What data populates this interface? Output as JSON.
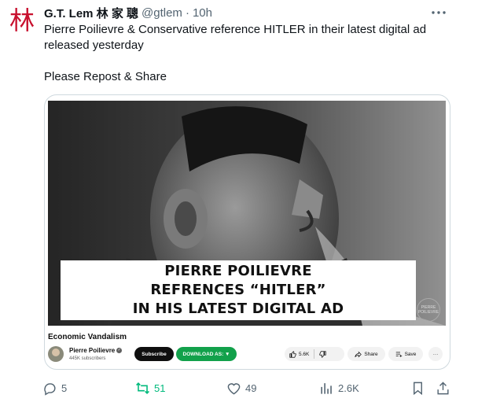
{
  "tweet": {
    "avatar_glyph": "林",
    "display_name": "G.T. Lem 林 家 聰",
    "handle": "@gtlem",
    "separator": "·",
    "time": "10h",
    "text_line1": "Pierre Poilievre & Conservative reference HITLER in their latest digital ad released yesterday",
    "text_line2": "Please Repost & Share"
  },
  "video": {
    "caption_lines": [
      "PIERRE POILIEVRE",
      "REFRENCES “HITLER”",
      "IN HIS LATEST DIGITAL AD"
    ],
    "watermark_text": "PIERRE POILIEVRE",
    "title": "Economic Vandalism",
    "channel_name": "Pierre Poilievre",
    "subscribers": "445K subscribers",
    "subscribe_label": "Subscribe",
    "download_label": "DOWNLOAD AS: ▼",
    "like_count": "5.6K",
    "share_label": "Share",
    "save_label": "Save",
    "more_label": "···"
  },
  "actions": {
    "replies": "5",
    "reposts": "51",
    "likes": "49",
    "views": "2.6K"
  },
  "colors": {
    "avatar_red": "#c8102e",
    "retweet_green": "#00ba7c",
    "muted_text": "#536471",
    "download_green": "#12a14b"
  },
  "icons": [
    "more-icon",
    "reply-icon",
    "repost-icon",
    "like-icon",
    "views-icon",
    "bookmark-icon",
    "share-icon",
    "thumbs-up-icon",
    "thumbs-down-icon",
    "youtube-share-icon",
    "save-playlist-icon",
    "verified-icon"
  ]
}
